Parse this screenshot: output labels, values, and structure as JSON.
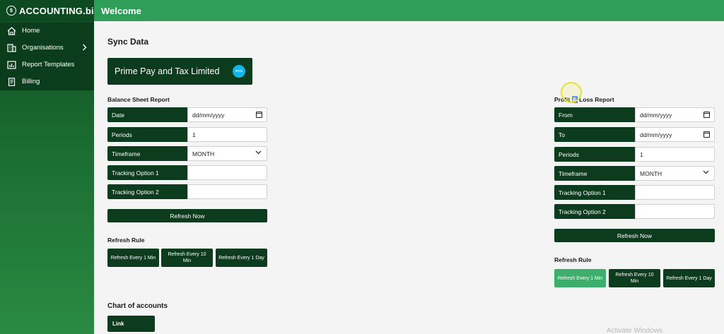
{
  "app": {
    "logo": "ACCOUNTING.bi",
    "header_title": "Welcome"
  },
  "sidebar": {
    "items": [
      {
        "label": "Home",
        "icon": "home-icon"
      },
      {
        "label": "Organisations",
        "icon": "building-icon",
        "has_chevron": true
      },
      {
        "label": "Report Templates",
        "icon": "report-icon"
      },
      {
        "label": "Billing",
        "icon": "billing-icon"
      }
    ]
  },
  "main": {
    "title": "Sync Data",
    "organisation": {
      "name": "Prime Pay and Tax Limited",
      "badge": "xero"
    },
    "balance_sheet": {
      "title": "Balance Sheet Report",
      "fields": [
        {
          "label": "Date",
          "value": "dd/mm/yyyy"
        },
        {
          "label": "Periods",
          "value": "1"
        },
        {
          "label": "Timeframe",
          "value": "MONTH"
        },
        {
          "label": "Tracking Option 1",
          "value": ""
        },
        {
          "label": "Tracking Option 2",
          "value": ""
        }
      ],
      "refresh_button": "Refresh Now",
      "refresh_rule_title": "Refresh Rule",
      "rules": [
        "Refresh Every 1 Min",
        "Refresh Every 10 Min",
        "Refresh Every 1 Day"
      ]
    },
    "profit_loss": {
      "title_part1": "Profit ",
      "title_selected": "&",
      "title_part2": " Loss Report",
      "fields": [
        {
          "label": "From",
          "value": "dd/mm/yyyy"
        },
        {
          "label": "To",
          "value": "dd/mm/yyyy"
        },
        {
          "label": "Periods",
          "value": "1"
        },
        {
          "label": "Timeframe",
          "value": "MONTH"
        },
        {
          "label": "Tracking Option 1",
          "value": ""
        },
        {
          "label": "Tracking Option 2",
          "value": ""
        }
      ],
      "refresh_button": "Refresh Now",
      "refresh_rule_title": "Refresh Rule",
      "rules": [
        "Refresh Every 1 Min",
        "Refresh Every 10 Min",
        "Refresh Every 1 Day"
      ],
      "active_rule_index": 0
    },
    "chart_of_accounts": {
      "title": "Chart of accounts",
      "link_label": "Link"
    },
    "watermark": "Activate Windows"
  },
  "colors": {
    "sidebar_dark": "#0d3b1e",
    "header_green": "#2e9e58",
    "active_green": "#3dae6c",
    "xero_blue": "#13b5ea"
  }
}
